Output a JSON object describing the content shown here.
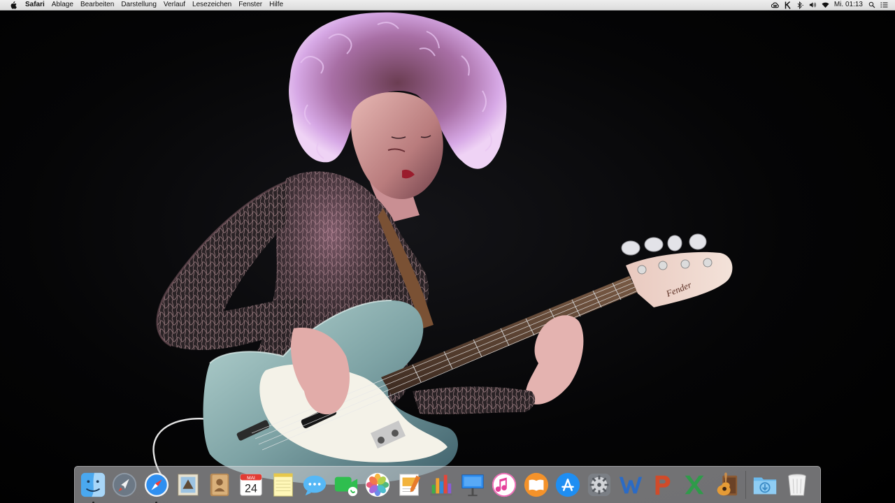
{
  "menubar": {
    "apple_icon": "apple-logo-icon",
    "app_name": "Safari",
    "menus": [
      "Ablage",
      "Bearbeiten",
      "Darstellung",
      "Verlauf",
      "Lesezeichen",
      "Fenster",
      "Hilfe"
    ],
    "status_icons": [
      "creative-cloud-icon",
      "klokki-icon",
      "bluetooth-icon",
      "volume-icon",
      "wifi-icon"
    ],
    "clock": "Mi. 01:13",
    "spotlight_icon": "spotlight-search-icon",
    "notification_icon": "notification-center-icon"
  },
  "desktop": {
    "wallpaper": "photo of a musician with curly hair playing a light-blue Fender bass guitar on a dark stage",
    "headstock_logo_text": "Fender"
  },
  "dock": {
    "apps": [
      {
        "name": "Finder",
        "icon": "finder-icon",
        "running": true
      },
      {
        "name": "Launchpad",
        "icon": "launchpad-icon",
        "running": false
      },
      {
        "name": "Safari",
        "icon": "safari-icon",
        "running": true
      },
      {
        "name": "Mail",
        "icon": "mail-icon",
        "running": false
      },
      {
        "name": "Kontakte",
        "icon": "contacts-icon",
        "running": false
      },
      {
        "name": "Kalender",
        "icon": "calendar-icon",
        "running": false
      },
      {
        "name": "Notizen",
        "icon": "notes-icon",
        "running": false
      },
      {
        "name": "Nachrichten",
        "icon": "messages-icon",
        "running": false
      },
      {
        "name": "FaceTime",
        "icon": "facetime-icon",
        "running": false
      },
      {
        "name": "Fotos",
        "icon": "photos-icon",
        "running": false
      },
      {
        "name": "Pages",
        "icon": "pages-icon",
        "running": false
      },
      {
        "name": "Numbers",
        "icon": "numbers-icon",
        "running": false
      },
      {
        "name": "Keynote",
        "icon": "keynote-icon",
        "running": false
      },
      {
        "name": "iTunes",
        "icon": "itunes-icon",
        "running": false
      },
      {
        "name": "iBooks",
        "icon": "ibooks-icon",
        "running": false
      },
      {
        "name": "App Store",
        "icon": "app-store-icon",
        "running": false
      },
      {
        "name": "Systemeinstellungen",
        "icon": "system-preferences-icon",
        "running": false
      },
      {
        "name": "Microsoft Word",
        "icon": "word-icon",
        "running": false
      },
      {
        "name": "Microsoft PowerPoint",
        "icon": "powerpoint-icon",
        "running": false
      },
      {
        "name": "Microsoft Excel",
        "icon": "excel-icon",
        "running": false
      },
      {
        "name": "GarageBand",
        "icon": "garageband-icon",
        "running": false
      }
    ],
    "stacks": [
      {
        "name": "Downloads",
        "icon": "downloads-folder-icon"
      },
      {
        "name": "Papierkorb",
        "icon": "trash-icon"
      }
    ],
    "calendar": {
      "month": "MAI",
      "day": "24"
    }
  },
  "colors": {
    "menubar_bg": "#e6e6e6",
    "desktop_bg": "#000000",
    "bass_body": "#8fb3b2",
    "hair_highlight": "#c89ad8"
  }
}
